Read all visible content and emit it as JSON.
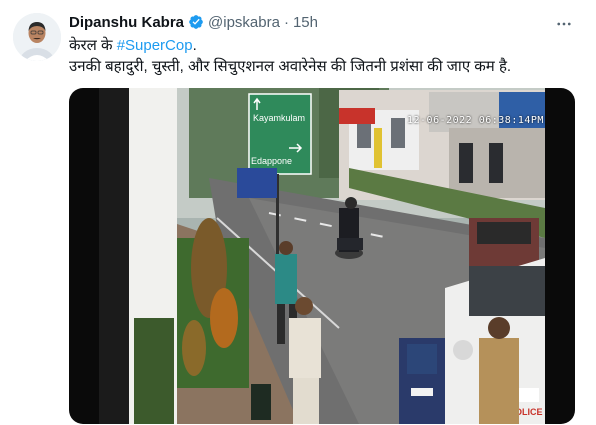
{
  "author": {
    "display_name": "Dipanshu Kabra",
    "handle": "@ipskabra",
    "separator": "·",
    "time": "15h"
  },
  "tweet": {
    "line1_text": "केरल के ",
    "hashtag": "#SuperCop",
    "line1_end": ".",
    "line2_text": "उनकी बहादुरी, चुस्ती, और सिचुएशनल अवारेनेस की जितनी प्रशंसा की जाए कम है."
  },
  "video": {
    "timestamp": "12-06-2022 06:38:14PM",
    "sign_text_1": "Kayamkulam",
    "sign_text_2": "Edappone",
    "vehicle_plate": "POLICE"
  },
  "colors": {
    "accent": "#1d9bf0",
    "secondary_text": "#536471",
    "primary_text": "#0f1419"
  },
  "icons": {
    "verified": "verified-badge-icon",
    "more": "more-options-icon"
  }
}
